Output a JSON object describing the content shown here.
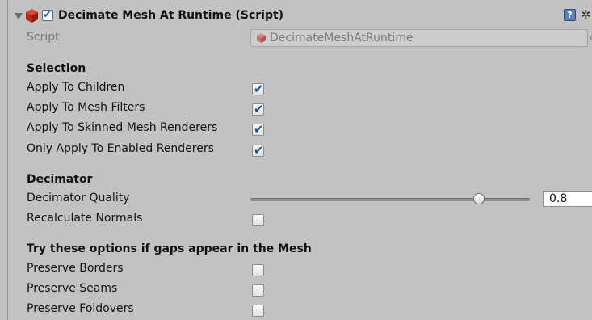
{
  "component": {
    "title": "Decimate Mesh At Runtime (Script)",
    "enabled": true
  },
  "script": {
    "label": "Script",
    "value": "DecimateMeshAtRuntime"
  },
  "selection": {
    "header": "Selection",
    "rows": [
      {
        "label": "Apply To Children",
        "checked": true
      },
      {
        "label": "Apply To Mesh Filters",
        "checked": true
      },
      {
        "label": "Apply To Skinned Mesh Renderers",
        "checked": true
      },
      {
        "label": "Only Apply To Enabled Renderers",
        "checked": true
      }
    ]
  },
  "decimator": {
    "header": "Decimator",
    "quality_label": "Decimator Quality",
    "quality_value": "0.8",
    "quality": 0.8,
    "recalc_label": "Recalculate Normals",
    "recalc_checked": false
  },
  "gaps": {
    "header": "Try these options if gaps appear in the Mesh",
    "rows": [
      {
        "label": "Preserve Borders",
        "checked": false
      },
      {
        "label": "Preserve Seams",
        "checked": false
      },
      {
        "label": "Preserve Foldovers",
        "checked": false
      }
    ]
  },
  "icons": {
    "foldout": "triangle-down-icon",
    "component": "cube-icon",
    "help": "help-book-icon",
    "settings": "gear-icon"
  }
}
